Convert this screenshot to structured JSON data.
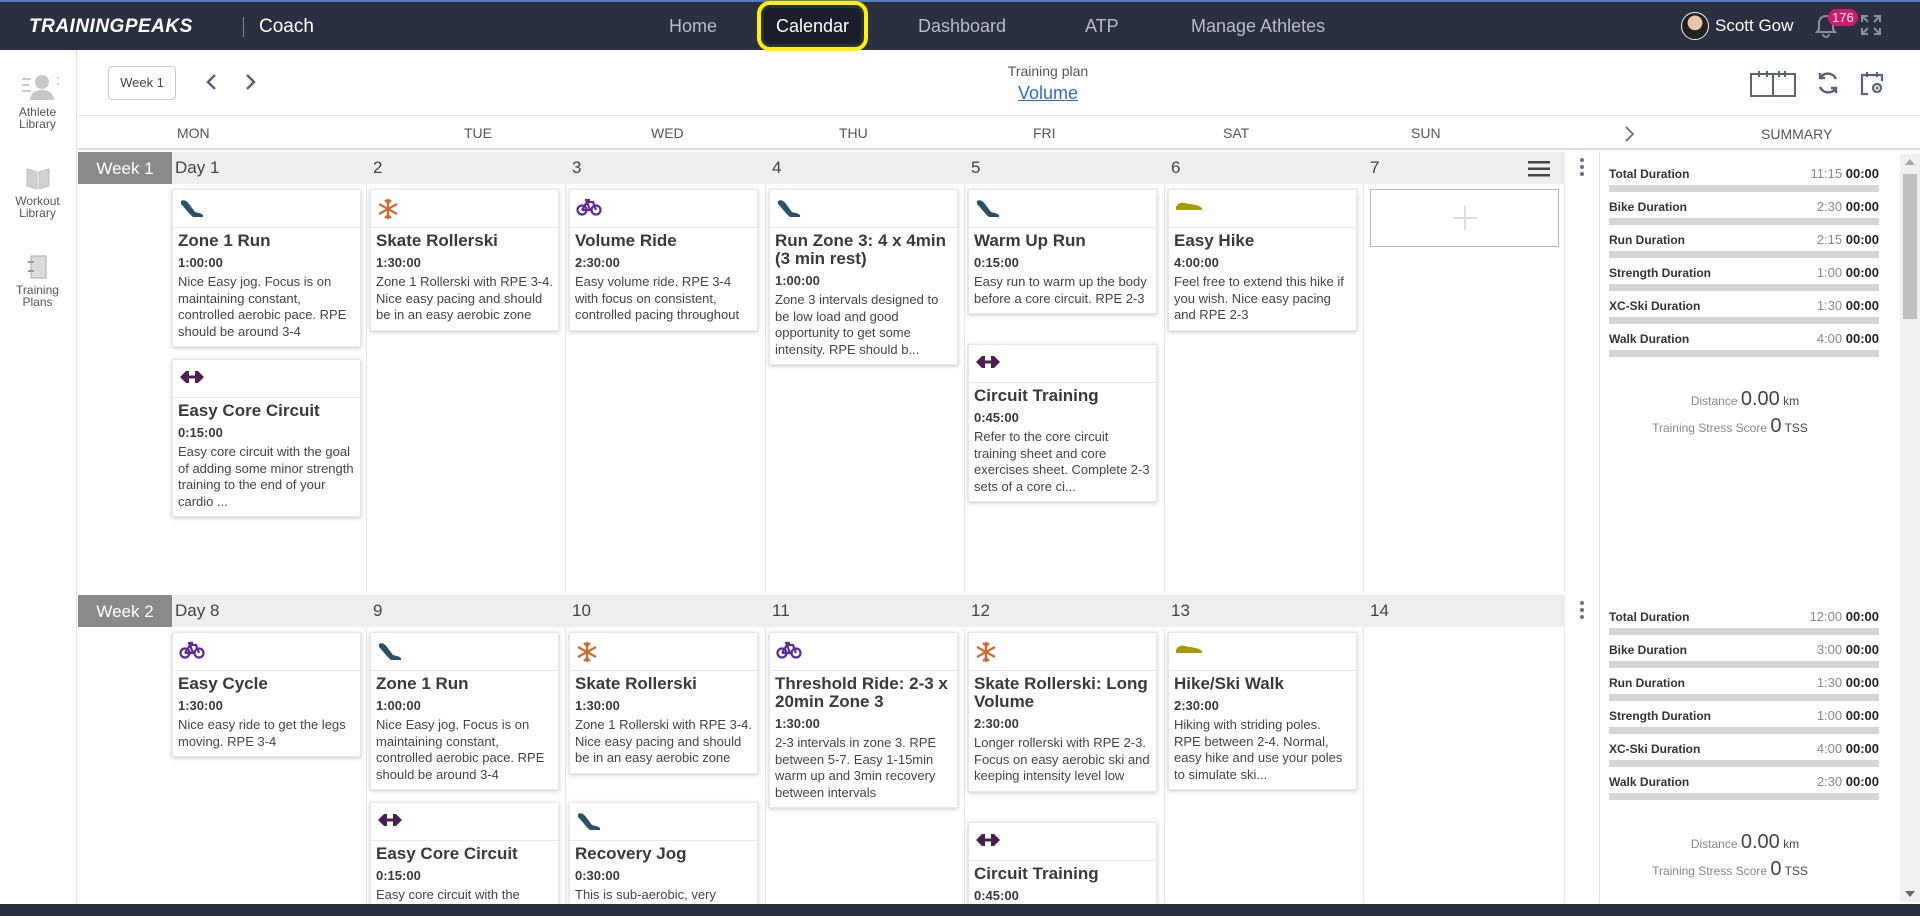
{
  "header": {
    "logo": "TRAININGPEAKS",
    "app_name": "Coach",
    "nav": [
      {
        "label": "Home",
        "active": false
      },
      {
        "label": "Calendar",
        "active": true
      },
      {
        "label": "Dashboard",
        "active": false
      },
      {
        "label": "ATP",
        "active": false
      },
      {
        "label": "Manage Athletes",
        "active": false
      }
    ],
    "user_name": "Scott Gow",
    "notification_count": "176"
  },
  "sidebar": {
    "items": [
      {
        "label_line1": "Athlete",
        "label_line2": "Library",
        "icon": "athlete-library-icon"
      },
      {
        "label_line1": "Workout",
        "label_line2": "Library",
        "icon": "book-icon"
      },
      {
        "label_line1": "Training",
        "label_line2": "Plans",
        "icon": "notebook-icon"
      }
    ]
  },
  "toolbar": {
    "week_button": "Week 1",
    "plan_label": "Training plan",
    "plan_name": "Volume"
  },
  "day_headers": [
    "MON",
    "TUE",
    "WED",
    "THU",
    "FRI",
    "SAT",
    "SUN"
  ],
  "summary_header": "SUMMARY",
  "colors": {
    "run": "#2c5068",
    "xcski": "#d2692c",
    "bike": "#5a2b9a",
    "strength": "#4b1f52",
    "hike": "#a89a00",
    "nav_bg": "#2a3040",
    "highlight": "#fff200",
    "badge": "#d3196b",
    "link": "#2a6bd4"
  },
  "weeks": [
    {
      "label": "Week 1",
      "days": [
        {
          "num": "Day 1",
          "workouts": [
            {
              "sport": "run",
              "title": "Zone 1 Run",
              "duration": "1:00:00",
              "desc": "Nice Easy jog. Focus is on maintaining constant, controlled aerobic pace. RPE should be around 3-4"
            },
            {
              "sport": "strength",
              "title": "Easy Core Circuit",
              "duration": "0:15:00",
              "desc": "Easy core circuit with the goal of adding some minor strength training to the end of your cardio ..."
            }
          ]
        },
        {
          "num": "2",
          "workouts": [
            {
              "sport": "xcski",
              "title": "Skate Rollerski",
              "duration": "1:30:00",
              "desc": "Zone 1 Rollerski with RPE 3-4. Nice easy pacing and should be in an easy aerobic zone"
            }
          ]
        },
        {
          "num": "3",
          "workouts": [
            {
              "sport": "bike",
              "title": "Volume Ride",
              "duration": "2:30:00",
              "desc": "Easy volume ride. RPE 3-4 with focus on consistent, controlled pacing throughout"
            }
          ]
        },
        {
          "num": "4",
          "workouts": [
            {
              "sport": "run",
              "title": "Run Zone 3: 4 x 4min (3 min rest)",
              "duration": "1:00:00",
              "desc": "Zone 3 intervals designed to be low load and good opportunity to get some intensity. RPE should b..."
            }
          ]
        },
        {
          "num": "5",
          "workouts": [
            {
              "sport": "run",
              "title": "Warm Up Run",
              "duration": "0:15:00",
              "desc": "Easy run to warm up the body before a core circuit. RPE 2-3"
            },
            {
              "sport": "strength",
              "title": "Circuit Training",
              "duration": "0:45:00",
              "desc": "Refer to the core circuit training sheet and core exercises sheet. Complete 2-3 sets of a core ci..."
            }
          ]
        },
        {
          "num": "6",
          "workouts": [
            {
              "sport": "hike",
              "title": "Easy Hike",
              "duration": "4:00:00",
              "desc": "Feel free to extend this hike if you wish. Nice easy pacing and RPE 2-3"
            }
          ]
        },
        {
          "num": "7",
          "workouts": []
        }
      ],
      "summary": {
        "rows": [
          {
            "label": "Total Duration",
            "planned": "11:15",
            "completed": "00:00"
          },
          {
            "label": "Bike Duration",
            "planned": "2:30",
            "completed": "00:00"
          },
          {
            "label": "Run Duration",
            "planned": "2:15",
            "completed": "00:00"
          },
          {
            "label": "Strength Duration",
            "planned": "1:00",
            "completed": "00:00"
          },
          {
            "label": "XC-Ski Duration",
            "planned": "1:30",
            "completed": "00:00"
          },
          {
            "label": "Walk Duration",
            "planned": "4:00",
            "completed": "00:00"
          }
        ],
        "distance_label": "Distance",
        "distance": "0.00",
        "distance_unit": "km",
        "tss_label": "Training Stress Score",
        "tss": "0",
        "tss_unit": "TSS"
      }
    },
    {
      "label": "Week 2",
      "days": [
        {
          "num": "Day 8",
          "workouts": [
            {
              "sport": "bike",
              "title": "Easy Cycle",
              "duration": "1:30:00",
              "desc": "Nice easy ride to get the legs moving. RPE 3-4"
            }
          ]
        },
        {
          "num": "9",
          "workouts": [
            {
              "sport": "run",
              "title": "Zone 1 Run",
              "duration": "1:00:00",
              "desc": "Nice Easy jog. Focus is on maintaining constant, controlled aerobic pace. RPE should be around 3-4"
            },
            {
              "sport": "strength",
              "title": "Easy Core Circuit",
              "duration": "0:15:00",
              "desc": "Easy core circuit with the"
            }
          ]
        },
        {
          "num": "10",
          "workouts": [
            {
              "sport": "xcski",
              "title": "Skate Rollerski",
              "duration": "1:30:00",
              "desc": "Zone 1 Rollerski with RPE 3-4. Nice easy pacing and should be in an easy aerobic zone"
            },
            {
              "sport": "run",
              "title": "Recovery Jog",
              "duration": "0:30:00",
              "desc": "This is sub-aerobic, very"
            }
          ]
        },
        {
          "num": "11",
          "workouts": [
            {
              "sport": "bike",
              "title": "Threshold Ride: 2-3 x 20min Zone 3",
              "duration": "1:30:00",
              "desc": "2-3 intervals in zone 3. RPE between 5-7. Easy 1-15min warm up and 3min recovery between intervals"
            }
          ]
        },
        {
          "num": "12",
          "workouts": [
            {
              "sport": "xcski",
              "title": "Skate Rollerski: Long Volume",
              "duration": "2:30:00",
              "desc": "Longer rollerski with RPE 2-3. Focus on easy aerobic ski and keeping intensity level low"
            },
            {
              "sport": "strength",
              "title": "Circuit Training",
              "duration": "0:45:00",
              "desc": ""
            }
          ]
        },
        {
          "num": "13",
          "workouts": [
            {
              "sport": "hike",
              "title": "Hike/Ski Walk",
              "duration": "2:30:00",
              "desc": "Hiking with striding poles. RPE between 2-4. Normal, easy hike and use your poles to simulate ski..."
            }
          ]
        },
        {
          "num": "14",
          "workouts": []
        }
      ],
      "summary": {
        "rows": [
          {
            "label": "Total Duration",
            "planned": "12:00",
            "completed": "00:00"
          },
          {
            "label": "Bike Duration",
            "planned": "3:00",
            "completed": "00:00"
          },
          {
            "label": "Run Duration",
            "planned": "1:30",
            "completed": "00:00"
          },
          {
            "label": "Strength Duration",
            "planned": "1:00",
            "completed": "00:00"
          },
          {
            "label": "XC-Ski Duration",
            "planned": "4:00",
            "completed": "00:00"
          },
          {
            "label": "Walk Duration",
            "planned": "2:30",
            "completed": "00:00"
          }
        ],
        "distance_label": "Distance",
        "distance": "0.00",
        "distance_unit": "km",
        "tss_label": "Training Stress Score",
        "tss": "0",
        "tss_unit": "TSS"
      }
    }
  ]
}
